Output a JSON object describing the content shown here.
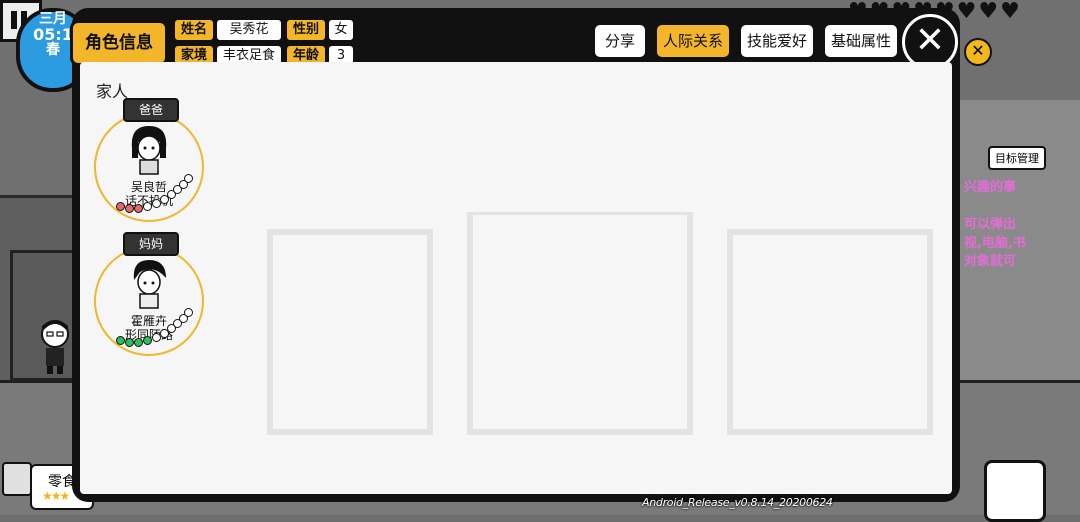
{
  "hud": {
    "month": "三月",
    "time": "05:1",
    "season": "春",
    "goal_button": "目标管理",
    "hint_lines": [
      "兴趣的事",
      "可以弹出",
      "视,电脑,书",
      "对象就可"
    ],
    "snack_label": "零食",
    "snack_stars": "★★★",
    "version": "Android_Release_v0.8.14_20200624"
  },
  "dialog": {
    "title_tab": "角色信息",
    "info": {
      "name_key": "姓名",
      "name_val": "吴秀花",
      "gender_key": "性别",
      "gender_val": "女",
      "family_key": "家境",
      "family_val": "丰衣足食",
      "age_key": "年龄",
      "age_val": "3"
    },
    "tabs": {
      "share": "分享",
      "relations": "人际关系",
      "skills": "技能爱好",
      "attributes": "基础属性"
    },
    "close_symbol": "✕",
    "section_family": "家人",
    "members": [
      {
        "role": "爸爸",
        "name": "吴良哲",
        "relation": "话不投机",
        "dots": [
          "red",
          "red",
          "red",
          "white",
          "white",
          "white",
          "white",
          "white",
          "white",
          "white"
        ]
      },
      {
        "role": "妈妈",
        "name": "霍雁卉",
        "relation": "形同陌路",
        "dots": [
          "green",
          "green",
          "green",
          "green",
          "white",
          "white",
          "white",
          "white",
          "white",
          "white"
        ]
      }
    ]
  },
  "colors": {
    "accent": "#f3b52a",
    "clock_blue": "#2c9be0",
    "hint_pink": "#e36dd6"
  }
}
